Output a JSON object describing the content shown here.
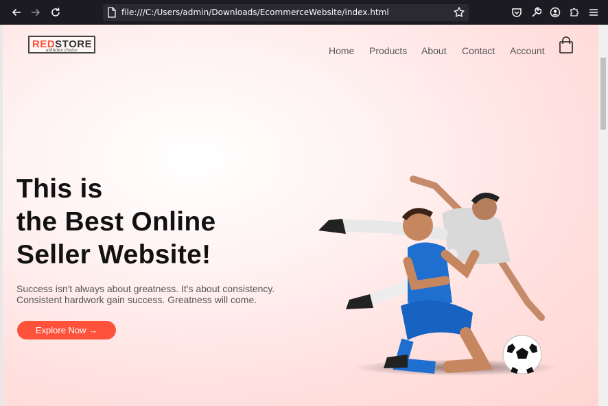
{
  "browser": {
    "url": "file:///C:/Users/admin/Downloads/EcommerceWebsite/index.html",
    "icons": [
      "back-icon",
      "forward-icon",
      "reload-icon",
      "page-icon",
      "bookmark-star-icon",
      "pocket-icon",
      "wrench-icon",
      "account-icon",
      "extensions-icon",
      "menu-icon"
    ]
  },
  "header": {
    "logo": {
      "red": "RED",
      "dark": "STORE",
      "tagline": "athletes choice"
    },
    "nav": [
      "Home",
      "Products",
      "About",
      "Contact",
      "Account"
    ],
    "cart_icon": "shopping-bag-icon"
  },
  "hero": {
    "title_lines": [
      "This is",
      "the Best Online",
      "Seller Website!"
    ],
    "subtitle_lines": [
      "Success isn't always about greatness. It's about consistency.",
      "Consistent hardwork gain success. Greatness will come."
    ],
    "cta": "Explore Now →",
    "image": "football-players-image"
  },
  "colors": {
    "accent": "#ff523b",
    "page_bg": "#ffd6d4",
    "toolbar": "#1c1b22"
  }
}
